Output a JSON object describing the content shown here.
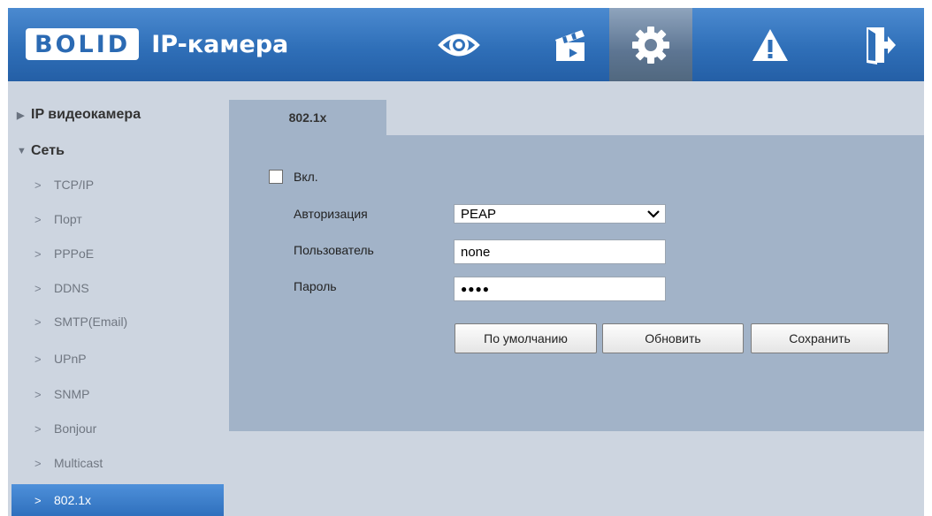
{
  "header": {
    "logo_brand": "BOLID",
    "app_title": "IP-камера",
    "nav": [
      {
        "name": "live-view",
        "icon": "eye-icon"
      },
      {
        "name": "playback",
        "icon": "clapperboard-icon"
      },
      {
        "name": "setup",
        "icon": "gear-icon",
        "active": true
      },
      {
        "name": "alarm",
        "icon": "warning-icon"
      },
      {
        "name": "logout",
        "icon": "exit-door-icon"
      }
    ]
  },
  "sidebar": {
    "groups": [
      {
        "label": "IP видеокамера",
        "expanded": false
      },
      {
        "label": "Сеть",
        "expanded": true
      }
    ],
    "items": [
      {
        "label": "TCP/IP"
      },
      {
        "label": "Порт"
      },
      {
        "label": "PPPoE"
      },
      {
        "label": "DDNS"
      },
      {
        "label": "SMTP(Email)"
      },
      {
        "label": "UPnP"
      },
      {
        "label": "SNMP"
      },
      {
        "label": "Bonjour"
      },
      {
        "label": "Multicast"
      },
      {
        "label": "802.1x",
        "active": true
      }
    ]
  },
  "main": {
    "tab_label": "802.1x",
    "enable_label": "Вкл.",
    "enable_checked": false,
    "auth_label": "Авторизация",
    "auth_value": "PEAP",
    "user_label": "Пользователь",
    "user_value": "none",
    "password_label": "Пароль",
    "password_masked": "●●●●",
    "buttons": {
      "default": "По умолчанию",
      "refresh": "Обновить",
      "save": "Сохранить"
    }
  },
  "colors": {
    "header_blue": "#2f6fb8",
    "active_nav": "#5d7592",
    "panel": "#a2b3c8",
    "background": "#cdd5e0",
    "sidebar_active": "#3a7fcc"
  }
}
